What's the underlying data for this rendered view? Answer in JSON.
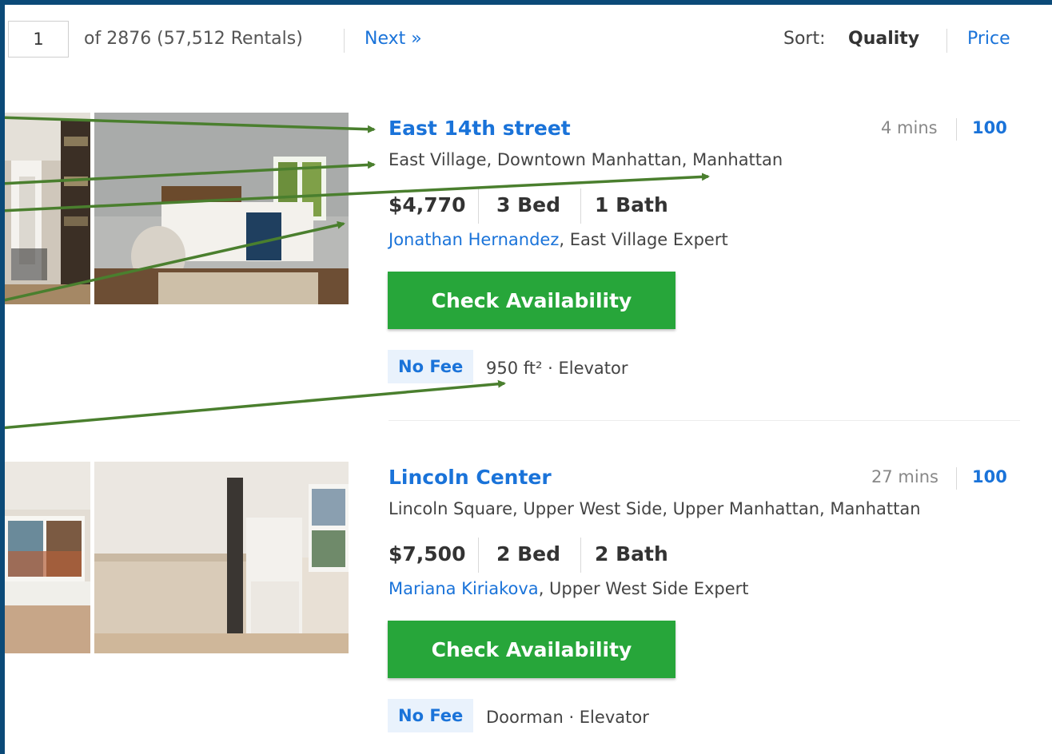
{
  "pagination": {
    "current_page": "1",
    "summary": "of 2876 (57,512 Rentals)",
    "next_label": "Next »"
  },
  "sort": {
    "label": "Sort:",
    "options": [
      "Quality",
      "Price"
    ],
    "selected": "Quality"
  },
  "listings": [
    {
      "title": "East 14th street",
      "time": "4 mins",
      "score": "100",
      "area": "East Village, Downtown Manhattan, Manhattan",
      "price": "$4,770",
      "beds": "3 Bed",
      "baths": "1 Bath",
      "agent_name": "Jonathan Hernandez",
      "agent_role": ", East Village Expert",
      "cta_label": "Check Availability",
      "badge": "No Fee",
      "features": "950 ft² · Elevator"
    },
    {
      "title": "Lincoln Center",
      "time": "27 mins",
      "score": "100",
      "area": "Lincoln Square, Upper West Side, Upper Manhattan, Manhattan",
      "price": "$7,500",
      "beds": "2 Bed",
      "baths": "2 Bath",
      "agent_name": "Mariana Kiriakova",
      "agent_role": ", Upper West Side Expert",
      "cta_label": "Check Availability",
      "badge": "No Fee",
      "features": "Doorman · Elevator"
    }
  ],
  "colors": {
    "link": "#1a73d9",
    "cta": "#27a63a",
    "badge_bg": "#e9f2fc",
    "annotation_arrow": "#4a7f2e",
    "frame": "#0b4a78"
  }
}
